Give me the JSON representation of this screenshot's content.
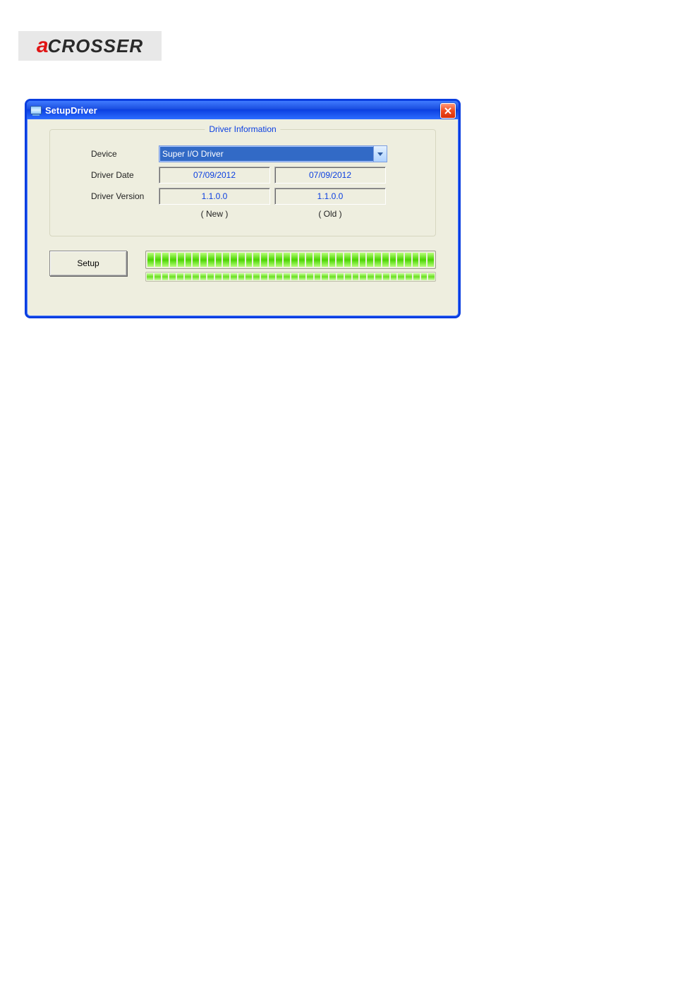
{
  "logo": {
    "prefix": "a",
    "rest": "CROSSER"
  },
  "window": {
    "title": "SetupDriver"
  },
  "fieldset": {
    "legend": "Driver Information",
    "labels": {
      "device": "Device",
      "driver_date": "Driver Date",
      "driver_version": "Driver Version"
    },
    "columns": {
      "new": "( New )",
      "old": "( Old )"
    },
    "device_selected": "Super I/O Driver",
    "date_new": "07/09/2012",
    "date_old": "07/09/2012",
    "version_new": "1.1.0.0",
    "version_old": "1.1.0.0"
  },
  "actions": {
    "setup": "Setup"
  },
  "progress": {
    "top_segments": 38,
    "bottom_segments": 38
  }
}
